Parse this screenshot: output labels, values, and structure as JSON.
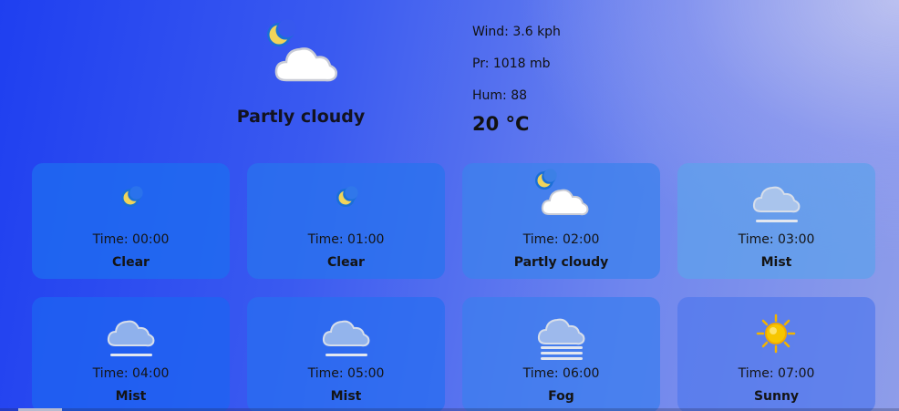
{
  "current": {
    "condition": "Partly cloudy",
    "icon": "partly-cloudy-night-icon",
    "wind": "Wind: 3.6 kph",
    "pressure": "Pr: 1018 mb",
    "humidity": "Hum: 88",
    "temperature": "20 °C"
  },
  "hourly": [
    {
      "time": "Time: 00:00",
      "condition": "Clear",
      "icon": "moon-icon"
    },
    {
      "time": "Time: 01:00",
      "condition": "Clear",
      "icon": "moon-icon"
    },
    {
      "time": "Time: 02:00",
      "condition": "Partly cloudy",
      "icon": "partly-cloudy-night-icon"
    },
    {
      "time": "Time: 03:00",
      "condition": "Mist",
      "icon": "mist-icon"
    },
    {
      "time": "Time: 04:00",
      "condition": "Mist",
      "icon": "mist-icon"
    },
    {
      "time": "Time: 05:00",
      "condition": "Mist",
      "icon": "mist-icon"
    },
    {
      "time": "Time: 06:00",
      "condition": "Fog",
      "icon": "fog-icon"
    },
    {
      "time": "Time: 07:00",
      "condition": "Sunny",
      "icon": "sun-icon"
    }
  ],
  "colors": {
    "moon": "#f0c84a",
    "moon_rim": "#1a6fd6",
    "cloud": "#ffffff",
    "sun": "#f7c600"
  }
}
